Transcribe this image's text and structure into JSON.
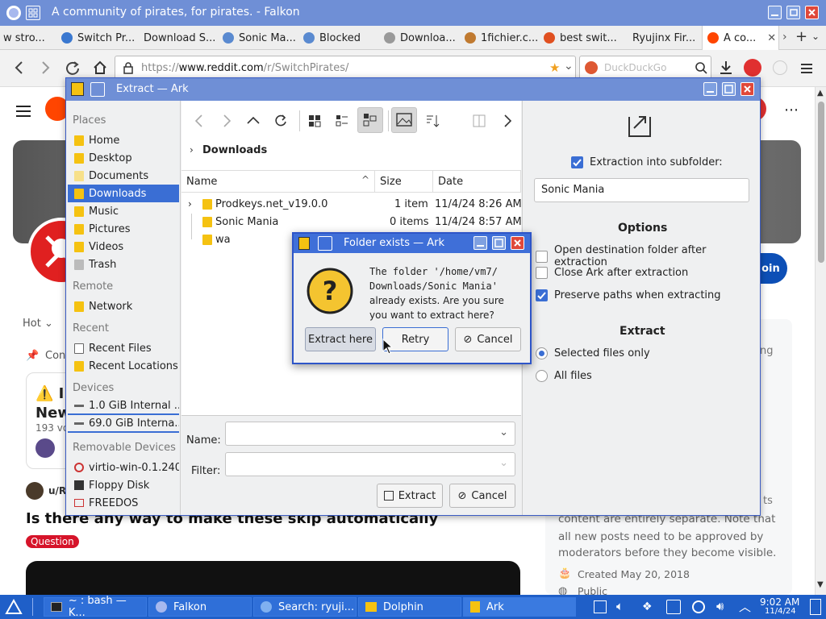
{
  "browser": {
    "title": "A community of pirates, for pirates. - Falkon",
    "tabs": [
      {
        "label": "w stro...",
        "color": "#888888"
      },
      {
        "label": "Switch Pr...",
        "color": "#3a78d0"
      },
      {
        "label": "Download S...",
        "color": "#e0e0e0"
      },
      {
        "label": "Sonic Ma...",
        "color": "#5a8ad0"
      },
      {
        "label": "Blocked",
        "color": "#5a8ad0"
      },
      {
        "label": "Downloa...",
        "color": "#999999"
      },
      {
        "label": "1fichier.c...",
        "color": "#c07a30"
      },
      {
        "label": "best swit...",
        "color": "#e05020"
      },
      {
        "label": "Ryujinx Fir...",
        "color": "#e0e0e0"
      },
      {
        "label": "A co...",
        "color": "#ff4500"
      }
    ],
    "url_prefix": "https://",
    "url_domain": "www.reddit.com",
    "url_path": "/r/SwitchPirates/",
    "search_placeholder": "DuckDuckGo"
  },
  "reddit": {
    "join": "Join",
    "sort": "Hot",
    "community_con": "Con",
    "post1_title": "⚠️ I",
    "post1_sub": "New",
    "post1_votes": "193 vo",
    "post_user": "u/R",
    "post_title": "Is there any way to make these skip automatically",
    "post_flair": "Question",
    "side_text_1": "ts",
    "side_text_2": "content are entirely separate. Note that",
    "side_text_3": "all new posts need to be approved by",
    "side_text_4": "moderators before they become visible.",
    "created": "Created May 20, 2018",
    "public": "Public",
    "side_ng": "ng"
  },
  "ark": {
    "title": "Extract — Ark",
    "breadcrumb": "Downloads",
    "places_header": "Places",
    "places": [
      "Home",
      "Desktop",
      "Documents",
      "Downloads",
      "Music",
      "Pictures",
      "Videos",
      "Trash"
    ],
    "remote_header": "Remote",
    "remote": [
      "Network"
    ],
    "recent_header": "Recent",
    "recent": [
      "Recent Files",
      "Recent Locations"
    ],
    "devices_header": "Devices",
    "devices": [
      "1.0 GiB Internal ...",
      "69.0 GiB Interna..."
    ],
    "removable_header": "Removable Devices",
    "removable": [
      "virtio-win-0.1.240",
      "Floppy Disk",
      "FREEDOS"
    ],
    "columns": {
      "name": "Name",
      "size": "Size",
      "date": "Date"
    },
    "files": [
      {
        "name": "Prodkeys.net_v19.0.0",
        "size": "1 item",
        "date": "11/4/24 8:26 AM"
      },
      {
        "name": "Sonic Mania",
        "size": "0 items",
        "date": "11/4/24 8:57 AM"
      },
      {
        "name": "wa",
        "size": "",
        "date": ""
      }
    ],
    "name_label": "Name:",
    "filter_label": "Filter:",
    "extract_btn": "Extract",
    "cancel_btn": "Cancel",
    "subfolder_label": "Extraction into subfolder:",
    "subfolder_value": "Sonic Mania",
    "options_header": "Options",
    "options": [
      {
        "label": "Open destination folder after extraction",
        "checked": false
      },
      {
        "label": "Close Ark after extraction",
        "checked": false
      },
      {
        "label": "Preserve paths when extracting",
        "checked": true
      }
    ],
    "extract_header": "Extract",
    "extract_modes": [
      {
        "label": "Selected files only",
        "selected": true
      },
      {
        "label": "All files",
        "selected": false
      }
    ]
  },
  "dialog": {
    "title": "Folder exists — Ark",
    "message_1": "The folder '/home/vm7/",
    "message_2": "Downloads/Sonic Mania'",
    "message_3": "already exists. Are you sure",
    "message_4": "you want to extract here?",
    "btn_extract_here": "Extract here",
    "btn_retry": "Retry",
    "btn_cancel": "Cancel"
  },
  "taskbar": {
    "items": [
      "~ : bash — K...",
      "Falkon",
      "Search: ryuji...",
      "Dolphin",
      "Ark"
    ],
    "time": "9:02 AM",
    "date": "11/4/24"
  }
}
